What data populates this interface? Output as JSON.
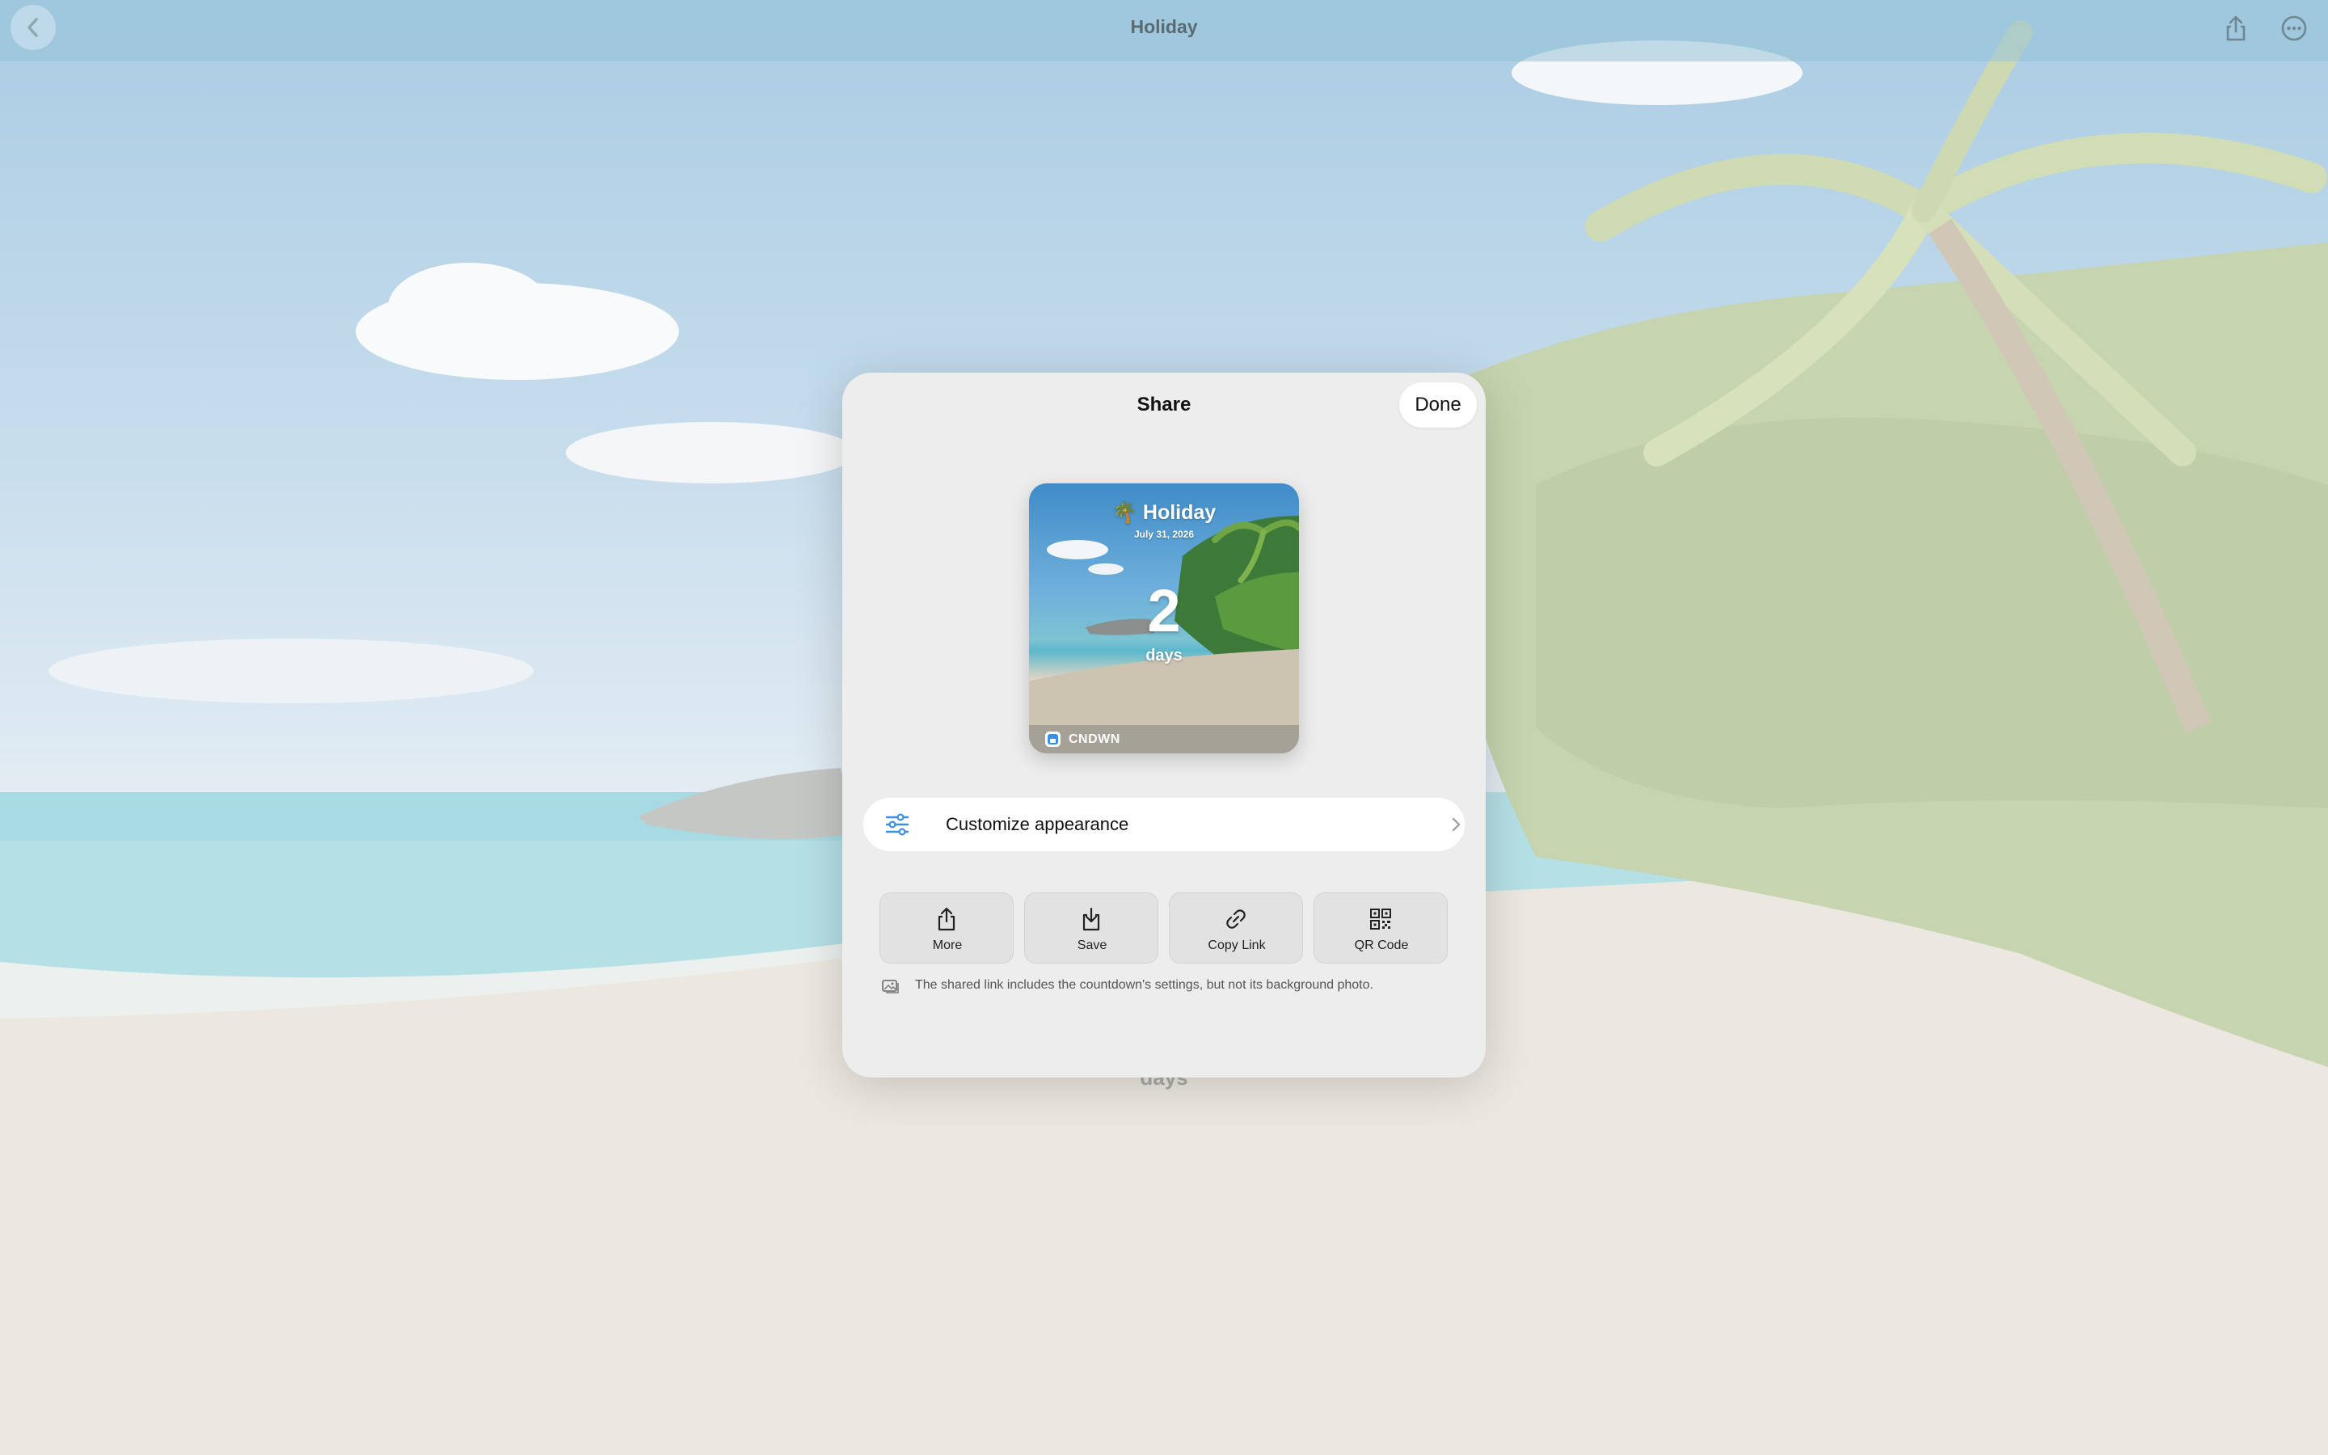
{
  "window": {
    "title": "Holiday"
  },
  "topbar": {
    "back_icon": "chevron-left-icon",
    "share_icon": "share-icon",
    "more_icon": "ellipsis-circle-icon"
  },
  "background": {
    "days_label": "days"
  },
  "share_sheet": {
    "title": "Share",
    "done_label": "Done",
    "preview": {
      "emoji": "🌴",
      "title": "Holiday",
      "date": "July 31, 2026",
      "count": "2",
      "unit": "days",
      "brand": "CNDWN"
    },
    "customize": {
      "label": "Customize appearance",
      "icon": "sliders-icon",
      "chevron": "chevron-right-icon"
    },
    "actions": [
      {
        "label": "More",
        "icon": "share-icon"
      },
      {
        "label": "Save",
        "icon": "download-icon"
      },
      {
        "label": "Copy Link",
        "icon": "link-icon"
      },
      {
        "label": "QR Code",
        "icon": "qr-code-icon"
      }
    ],
    "note": "The shared link includes the countdown's settings, but not its background photo.",
    "note_icon": "photo-icon"
  },
  "colors": {
    "accent": "#3a8ee6",
    "sheet_bg": "#ededed"
  }
}
